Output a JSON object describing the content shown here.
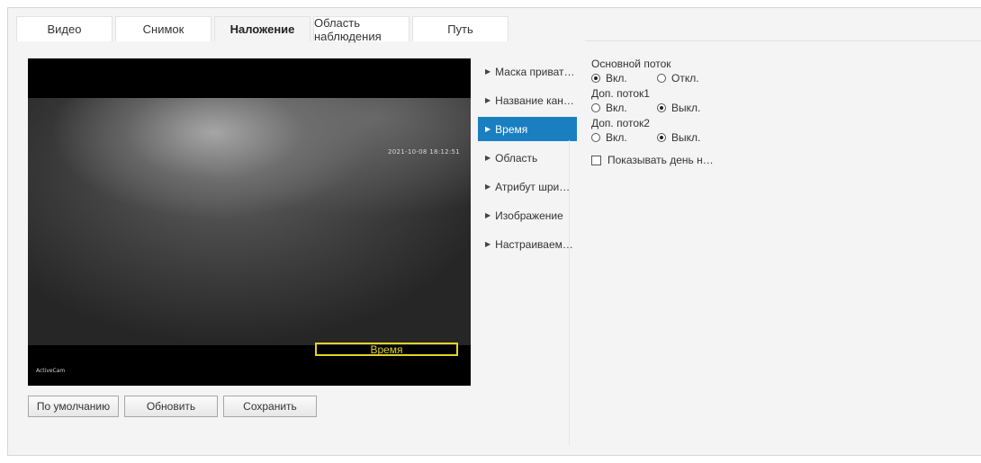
{
  "tabs": [
    {
      "label": "Видео"
    },
    {
      "label": "Снимок"
    },
    {
      "label": "Наложение"
    },
    {
      "label": "Область наблюдения"
    },
    {
      "label": "Путь"
    }
  ],
  "active_tab": "Наложение",
  "preview": {
    "osd_datetime": "2021-10-08 18:12:51",
    "osd_camera_name": "ActiveCam",
    "osd_time_box_label": "Время"
  },
  "buttons": {
    "default_label": "По умолчанию",
    "refresh_label": "Обновить",
    "save_label": "Сохранить"
  },
  "menu": {
    "items": [
      {
        "label": "Маска приват…"
      },
      {
        "label": "Название кан…"
      },
      {
        "label": "Время"
      },
      {
        "label": "Область"
      },
      {
        "label": "Атрибут шри…"
      },
      {
        "label": "Изображение"
      },
      {
        "label": "Настраиваем…"
      }
    ],
    "active": "Время"
  },
  "streams": {
    "main": {
      "label": "Основной поток",
      "on_label": "Вкл.",
      "off_label": "Откл.",
      "value": "on"
    },
    "sub1": {
      "label": "Доп. поток1",
      "on_label": "Вкл.",
      "off_label": "Выкл.",
      "value": "off"
    },
    "sub2": {
      "label": "Доп. поток2",
      "on_label": "Вкл.",
      "off_label": "Выкл.",
      "value": "off"
    }
  },
  "show_weekday": {
    "label": "Показывать день н…",
    "checked": false
  },
  "colors": {
    "accent": "#1a7fc1",
    "osd_box": "#e2d22a",
    "panel_bg": "#f4f4f4"
  }
}
